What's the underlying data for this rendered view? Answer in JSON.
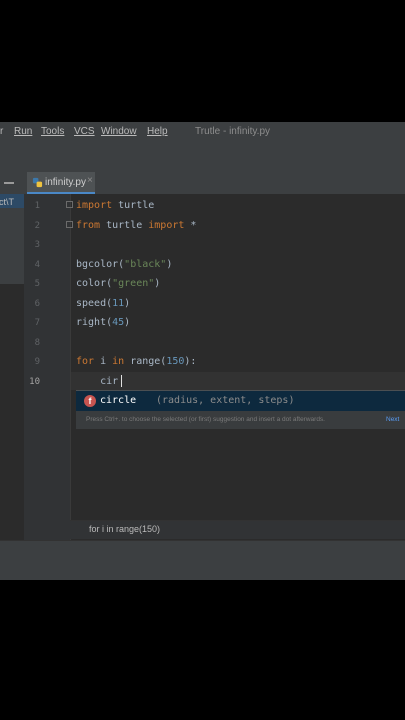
{
  "menubar": {
    "items": [
      {
        "label": "r"
      },
      {
        "label": "Run"
      },
      {
        "label": "Tools"
      },
      {
        "label": "VCS"
      },
      {
        "label": "Window"
      },
      {
        "label": "Help"
      }
    ],
    "window_title": "Trutle - infinity.py"
  },
  "tabs": [
    {
      "label": "infinity.py",
      "close": "×"
    }
  ],
  "project_panel": {
    "truncated_path": "ect\\T"
  },
  "editor": {
    "current_line": 10,
    "lines": [
      {
        "num": "1",
        "t": [
          {
            "c": "import",
            "k": "kw"
          },
          {
            "c": " turtle",
            "k": ""
          }
        ]
      },
      {
        "num": "2",
        "t": [
          {
            "c": "from",
            "k": "kw"
          },
          {
            "c": " turtle ",
            "k": ""
          },
          {
            "c": "import",
            "k": "kw"
          },
          {
            "c": " *",
            "k": ""
          }
        ]
      },
      {
        "num": "3",
        "t": []
      },
      {
        "num": "4",
        "t": [
          {
            "c": "bgcolor(",
            "k": ""
          },
          {
            "c": "\"black\"",
            "k": "str"
          },
          {
            "c": ")",
            "k": ""
          }
        ]
      },
      {
        "num": "5",
        "t": [
          {
            "c": "color(",
            "k": ""
          },
          {
            "c": "\"green\"",
            "k": "str"
          },
          {
            "c": ")",
            "k": ""
          }
        ]
      },
      {
        "num": "6",
        "t": [
          {
            "c": "speed(",
            "k": ""
          },
          {
            "c": "11",
            "k": "num"
          },
          {
            "c": ")",
            "k": ""
          }
        ]
      },
      {
        "num": "7",
        "t": [
          {
            "c": "right(",
            "k": ""
          },
          {
            "c": "45",
            "k": "num"
          },
          {
            "c": ")",
            "k": ""
          }
        ]
      },
      {
        "num": "8",
        "t": []
      },
      {
        "num": "9",
        "t": [
          {
            "c": "for",
            "k": "kw"
          },
          {
            "c": " i ",
            "k": ""
          },
          {
            "c": "in",
            "k": "kw"
          },
          {
            "c": " range(",
            "k": ""
          },
          {
            "c": "150",
            "k": "num"
          },
          {
            "c": "):",
            "k": ""
          }
        ]
      },
      {
        "num": "10",
        "t": [
          {
            "c": "    cir",
            "k": ""
          }
        ]
      }
    ]
  },
  "autocomplete": {
    "icon_letter": "f",
    "name": "circle",
    "params": "(radius, extent, steps)",
    "hint": "Press Ctrl+. to choose the selected (or first) suggestion and insert a dot afterwards.",
    "hint_link": "Next"
  },
  "breadcrumb": "for i in range(150)",
  "colors": {
    "editor_bg": "#2b2b2b",
    "keyword": "#cc7832",
    "string": "#6a8759",
    "number": "#6897bb",
    "default_text": "#a9b7c6",
    "accent": "#4a88c7"
  }
}
